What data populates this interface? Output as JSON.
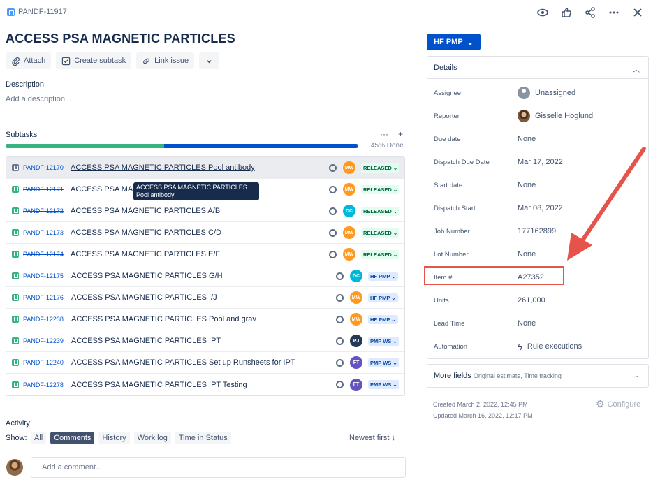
{
  "issue": {
    "key": "PANDF-11917",
    "title": "ACCESS PSA MAGNETIC PARTICLES"
  },
  "top_actions": [
    "watch-icon",
    "like-icon",
    "share-icon",
    "more-icon",
    "close-icon"
  ],
  "toolbar": {
    "attach": "Attach",
    "create_subtask": "Create subtask",
    "link_issue": "Link issue"
  },
  "description": {
    "label": "Description",
    "placeholder": "Add a description..."
  },
  "subtasks": {
    "label": "Subtasks",
    "progress_label": "45% Done",
    "progress_fraction": 0.45,
    "tooltip": "ACCESS PSA MAGNETIC PARTICLES Pool antibody",
    "items": [
      {
        "key": "PANDF-12170",
        "summary": "ACCESS PSA MAGNETIC PARTICLES Pool antibody",
        "done": true,
        "avatar": "MW",
        "status": "RELEASED"
      },
      {
        "key": "PANDF-12171",
        "summary": "ACCESS PSA MAGN",
        "done": true,
        "avatar": "MW",
        "status": "RELEASED"
      },
      {
        "key": "PANDF-12172",
        "summary": "ACCESS PSA MAGNETIC PARTICLES A/B",
        "done": true,
        "avatar": "DC",
        "status": "RELEASED"
      },
      {
        "key": "PANDF-12173",
        "summary": "ACCESS PSA MAGNETIC PARTICLES C/D",
        "done": true,
        "avatar": "MW",
        "status": "RELEASED"
      },
      {
        "key": "PANDF-12174",
        "summary": "ACCESS PSA MAGNETIC PARTICLES E/F",
        "done": true,
        "avatar": "MW",
        "status": "RELEASED"
      },
      {
        "key": "PANDF-12175",
        "summary": "ACCESS PSA MAGNETIC PARTICLES G/H",
        "done": false,
        "avatar": "DC",
        "status": "HF PMP"
      },
      {
        "key": "PANDF-12176",
        "summary": "ACCESS PSA MAGNETIC PARTICLES I/J",
        "done": false,
        "avatar": "MW",
        "status": "HF PMP"
      },
      {
        "key": "PANDF-12238",
        "summary": "ACCESS PSA MAGNETIC PARTICLES Pool and grav",
        "done": false,
        "avatar": "MW",
        "status": "HF PMP"
      },
      {
        "key": "PANDF-12239",
        "summary": "ACCESS PSA MAGNETIC PARTICLES IPT",
        "done": false,
        "avatar": "PJ",
        "status": "PMP WS"
      },
      {
        "key": "PANDF-12240",
        "summary": "ACCESS PSA MAGNETIC PARTICLES Set up Runsheets for IPT",
        "done": false,
        "avatar": "FT",
        "status": "PMP WS"
      },
      {
        "key": "PANDF-12278",
        "summary": "ACCESS PSA MAGNETIC PARTICLES IPT Testing",
        "done": false,
        "avatar": "FT",
        "status": "PMP WS"
      }
    ]
  },
  "activity": {
    "label": "Activity",
    "show_label": "Show:",
    "tabs": [
      "All",
      "Comments",
      "History",
      "Work log",
      "Time in Status"
    ],
    "active_tab": "Comments",
    "sort": "Newest first",
    "comment_placeholder": "Add a comment..."
  },
  "status_button": "HF PMP",
  "details": {
    "header": "Details",
    "fields": [
      {
        "label": "Assignee",
        "value": "Unassigned",
        "icon": "person-icon"
      },
      {
        "label": "Reporter",
        "value": "Gisselle Hoglund",
        "icon": "photo-avatar"
      },
      {
        "label": "Due date",
        "value": "None"
      },
      {
        "label": "Dispatch Due Date",
        "value": "Mar 17, 2022"
      },
      {
        "label": "Start date",
        "value": "None"
      },
      {
        "label": "Dispatch Start",
        "value": "Mar 08, 2022"
      },
      {
        "label": "Job Number",
        "value": "177162899"
      },
      {
        "label": "Lot Number",
        "value": "None"
      },
      {
        "label": "Item #",
        "value": "A27352"
      },
      {
        "label": "Units",
        "value": "261,000"
      },
      {
        "label": "Lead Time",
        "value": "None"
      },
      {
        "label": "Automation",
        "value": "Rule executions",
        "icon": "bolt-icon"
      }
    ]
  },
  "more_fields": {
    "label": "More fields",
    "hint": "Original estimate, Time tracking"
  },
  "meta": {
    "created": "Created March 2, 2022, 12:45 PM",
    "updated": "Updated March 16, 2022, 12:17 PM",
    "configure": "Configure"
  },
  "colors": {
    "accent": "#0052CC",
    "done_green": "#36B37E",
    "highlight_red": "#E5534B",
    "avatar_MW": "#FF991F",
    "avatar_DC": "#00B8D9",
    "avatar_PJ": "#253858",
    "avatar_FT": "#6554C0"
  }
}
